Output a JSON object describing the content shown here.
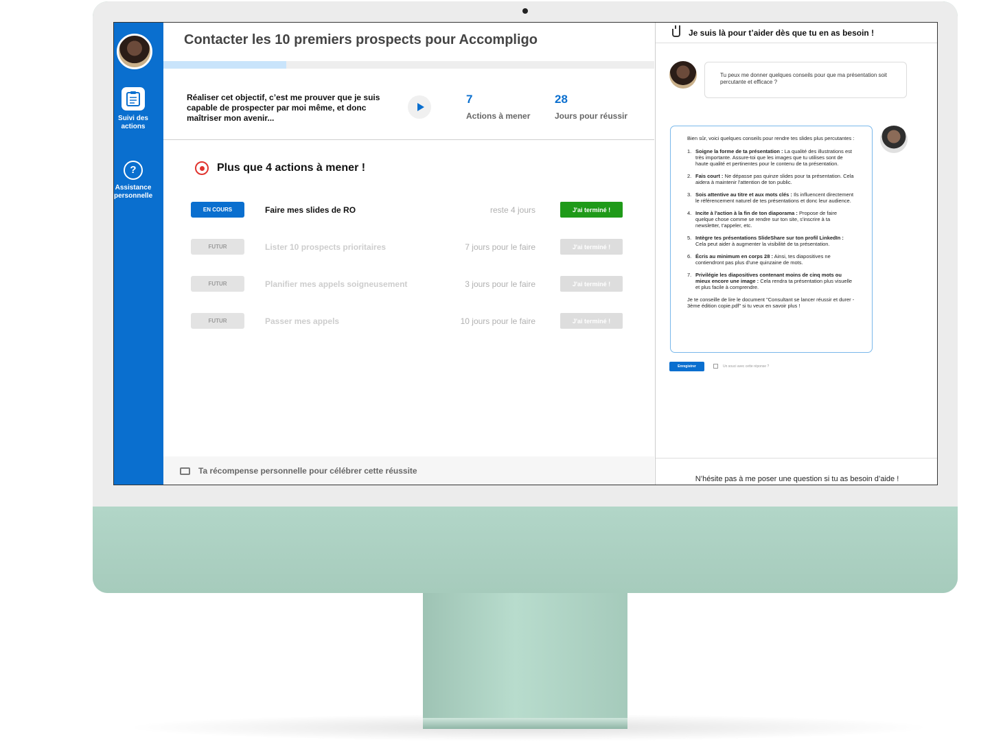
{
  "goal": {
    "title": "Contacter les 10 premiers prospects pour Accompligo",
    "objective": "Réaliser cet objectif, c’est me prouver que je suis capable de prospecter par moi même, et donc maîtriser mon avenir...",
    "actions_count": "7",
    "actions_label": "Actions à mener",
    "days_count": "28",
    "days_label": "Jours pour réussir",
    "progress": 0.25
  },
  "sidebar": {
    "items": [
      {
        "label": "Suivi des actions",
        "icon": "clipboard-icon"
      },
      {
        "label": "Assistance personnelle",
        "icon": "help-icon"
      }
    ]
  },
  "actions": {
    "heading": "Plus que 4 actions à mener !",
    "rows": [
      {
        "status": "EN COURS",
        "task": "Faire mes slides de RO",
        "deadline": "reste 4 jours",
        "button": "J'ai terminé !"
      },
      {
        "status": "FUTUR",
        "task": "Lister 10 prospects prioritaires",
        "deadline": "7 jours pour le faire",
        "button": "J'ai terminé !"
      },
      {
        "status": "FUTUR",
        "task": "Planifier mes appels soigneusement",
        "deadline": "3 jours pour le faire",
        "button": "J'ai terminé !"
      },
      {
        "status": "FUTUR",
        "task": "Passer mes appels",
        "deadline": "10 jours pour le faire",
        "button": "J'ai terminé !"
      }
    ]
  },
  "reward": {
    "label": "Ta récompense personnelle pour célébrer cette réussite"
  },
  "assistant": {
    "header": "Je suis là pour t’aider dès que tu en as besoin !",
    "question": "Tu peux me donner quelques conseils pour que ma présentation soit percutante  et efficace ?",
    "answer_intro": "Bien sûr, voici quelques conseils pour rendre tes slides plus percutantes :",
    "tips": [
      {
        "num": "1.",
        "title": "Soigne la forme de ta présentation :",
        "text": " La qualité des illustrations est très importante. Assure-toi que les images que tu utilises sont de haute qualité et pertinentes pour le contenu de ta présentation."
      },
      {
        "num": "2.",
        "title": "Fais court :",
        "text": " Ne dépasse pas quinze slides pour ta présentation. Cela aidera à maintenir l'attention de ton public."
      },
      {
        "num": "3.",
        "title": "Sois attentive au titre et aux mots clés :",
        "text": " Ils influencent directement le référencement naturel de tes présentations et donc leur audience."
      },
      {
        "num": "4.",
        "title": "Incite à l'action à la fin de ton diaporama :",
        "text": " Propose de faire quelque chose comme se rendre sur ton site, s'inscrire à ta newsletter, t'appeler, etc."
      },
      {
        "num": "5.",
        "title": "Intègre tes présentations SlideShare sur ton profil LinkedIn :",
        "text": " Cela peut aider à augmenter la visibilité de ta présentation."
      },
      {
        "num": "6.",
        "title": "Écris au minimum en corps 28 :",
        "text": " Ainsi, tes diapositives ne contiendront pas plus d'une quinzaine de mots."
      },
      {
        "num": "7.",
        "title": "Privilégie les diapositives contenant moins de cinq mots ou mieux encore une image :",
        "text": " Cela rendra ta présentation plus visuelle et plus facile à comprendre."
      }
    ],
    "answer_outro": "Je te conseille de lire le document \"Consultant se lancer réussir et durer - 3ème édition copie.pdf\" si tu veux en savoir plus !",
    "save_label": "Enregistrer",
    "feedback_label": "Un souci avec cette réponse ?",
    "footer": "N’hésite pas à me poser une question si tu as besoin d’aide !"
  },
  "colors": {
    "primary": "#0a6fcf",
    "success": "#1f9a19",
    "target_red": "#e0332e",
    "monitor_green": "#a9cfc0"
  }
}
